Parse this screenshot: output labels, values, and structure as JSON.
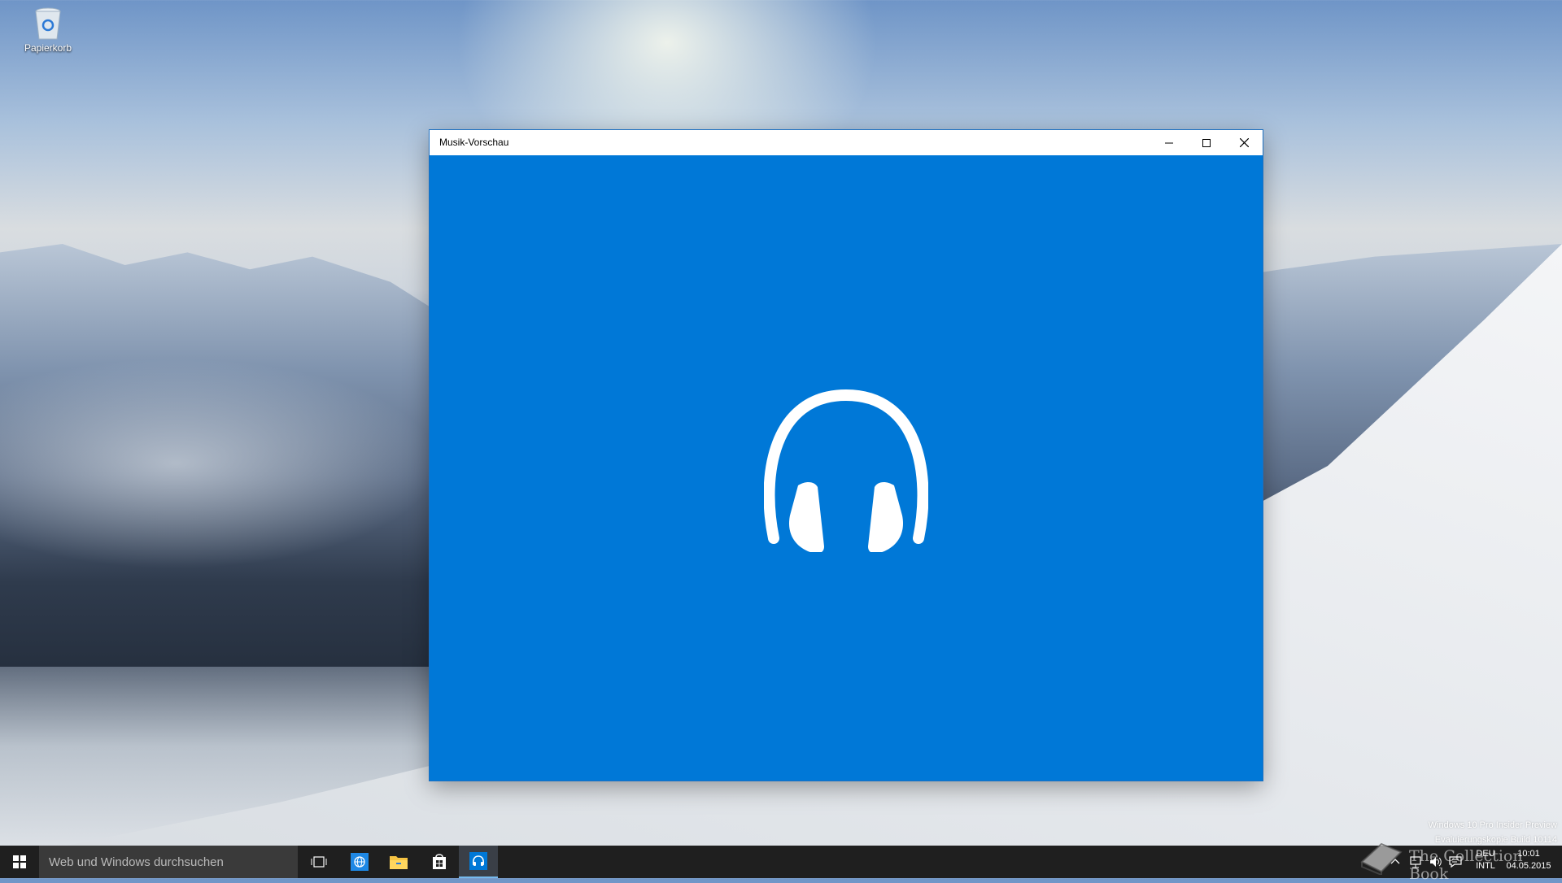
{
  "desktop": {
    "icons": [
      {
        "label": "Papierkorb",
        "icon": "recycle-bin-icon"
      }
    ],
    "watermark": {
      "line1": "Windows 10 Pro Insider Preview",
      "line2": "Evaluierungskopie Build 10114"
    }
  },
  "window": {
    "title": "Musik-Vorschau",
    "controls": {
      "minimize": "minimize-icon",
      "maximize": "maximize-icon",
      "close": "close-icon"
    },
    "splash_icon": "headphones-icon",
    "accent_color": "#0078d7"
  },
  "taskbar": {
    "search_placeholder": "Web und Windows durchsuchen",
    "pinned": [
      {
        "name": "task-view",
        "icon": "task-view-icon"
      },
      {
        "name": "browser",
        "icon": "globe-icon"
      },
      {
        "name": "file-explorer",
        "icon": "folder-icon"
      },
      {
        "name": "store",
        "icon": "store-icon"
      },
      {
        "name": "music",
        "icon": "headphones-icon",
        "active": true
      }
    ],
    "tray": {
      "language_top": "DEU",
      "language_bottom": "INTL",
      "time": "10:01",
      "date": "04.05.2015"
    }
  },
  "overlay_brand": "The Collection Book"
}
